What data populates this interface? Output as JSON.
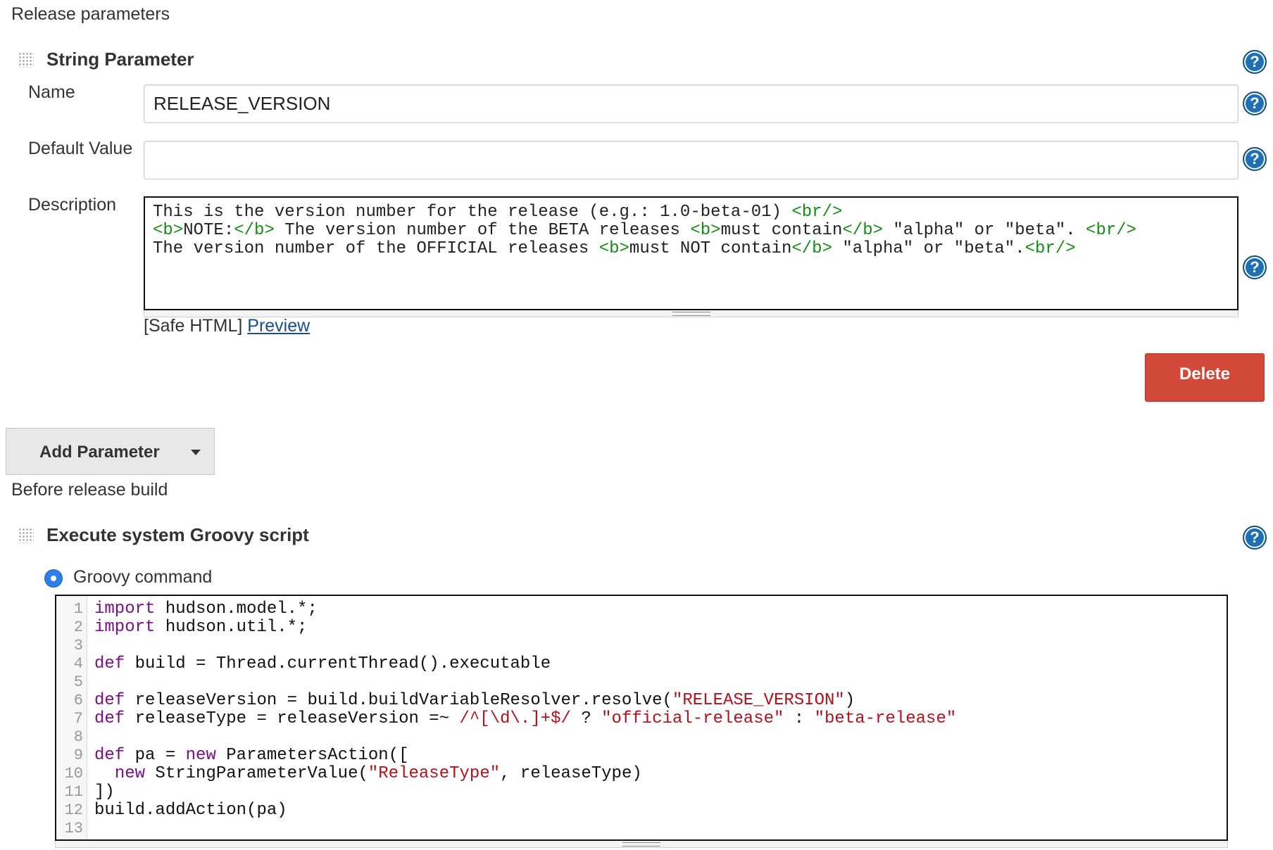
{
  "release_section": {
    "title": "Release parameters",
    "block_title": "String Parameter",
    "name_label": "Name",
    "name_value": "RELEASE_VERSION",
    "default_label": "Default Value",
    "default_value": "",
    "description_label": "Description",
    "description_lines": [
      [
        {
          "t": "This is the version number for the release (e.g.: 1.0-beta-01) ",
          "c": "text"
        },
        {
          "t": "<br/>",
          "c": "tag"
        }
      ],
      [
        {
          "t": "<b>",
          "c": "tag"
        },
        {
          "t": "NOTE:",
          "c": "text"
        },
        {
          "t": "</b>",
          "c": "tag"
        },
        {
          "t": " The version number of the BETA releases ",
          "c": "text"
        },
        {
          "t": "<b>",
          "c": "tag"
        },
        {
          "t": "must contain",
          "c": "text"
        },
        {
          "t": "</b>",
          "c": "tag"
        },
        {
          "t": " \"alpha\" or \"beta\". ",
          "c": "text"
        },
        {
          "t": "<br/>",
          "c": "tag"
        }
      ],
      [
        {
          "t": "The version number of the OFFICIAL releases ",
          "c": "text"
        },
        {
          "t": "<b>",
          "c": "tag"
        },
        {
          "t": "must NOT contain",
          "c": "text"
        },
        {
          "t": "</b>",
          "c": "tag"
        },
        {
          "t": " \"alpha\" or \"beta\".",
          "c": "text"
        },
        {
          "t": "<br/>",
          "c": "tag"
        }
      ]
    ],
    "safe_html_label": "[Safe HTML]",
    "preview_link": "Preview",
    "delete_button": "Delete"
  },
  "add_parameter_button": "Add Parameter",
  "before_build_section": {
    "title": "Before release build",
    "block_title": "Execute system Groovy script",
    "radio_label": "Groovy command",
    "radio_selected": true,
    "code_lines": [
      {
        "n": "1",
        "parts": [
          {
            "t": "import",
            "c": "kw"
          },
          {
            "t": " hudson.model.*;",
            "c": "text"
          }
        ]
      },
      {
        "n": "2",
        "parts": [
          {
            "t": "import",
            "c": "kw"
          },
          {
            "t": " hudson.util.*;",
            "c": "text"
          }
        ]
      },
      {
        "n": "3",
        "parts": []
      },
      {
        "n": "4",
        "parts": [
          {
            "t": "def",
            "c": "kw"
          },
          {
            "t": " build = Thread.currentThread().executable",
            "c": "text"
          }
        ]
      },
      {
        "n": "5",
        "parts": []
      },
      {
        "n": "6",
        "parts": [
          {
            "t": "def",
            "c": "kw"
          },
          {
            "t": " releaseVersion = build.buildVariableResolver.resolve(",
            "c": "text"
          },
          {
            "t": "\"RELEASE_VERSION\"",
            "c": "str"
          },
          {
            "t": ")",
            "c": "text"
          }
        ]
      },
      {
        "n": "7",
        "parts": [
          {
            "t": "def",
            "c": "kw"
          },
          {
            "t": " releaseType = releaseVersion =~ ",
            "c": "text"
          },
          {
            "t": "/^[\\d\\.]+$/",
            "c": "str"
          },
          {
            "t": " ? ",
            "c": "text"
          },
          {
            "t": "\"official-release\"",
            "c": "str"
          },
          {
            "t": " : ",
            "c": "text"
          },
          {
            "t": "\"beta-release\"",
            "c": "str"
          }
        ]
      },
      {
        "n": "8",
        "parts": []
      },
      {
        "n": "9",
        "parts": [
          {
            "t": "def",
            "c": "kw"
          },
          {
            "t": " pa = ",
            "c": "text"
          },
          {
            "t": "new",
            "c": "kw"
          },
          {
            "t": " ParametersAction([",
            "c": "text"
          }
        ]
      },
      {
        "n": "10",
        "parts": [
          {
            "t": "  ",
            "c": "text"
          },
          {
            "t": "new",
            "c": "kw"
          },
          {
            "t": " StringParameterValue(",
            "c": "text"
          },
          {
            "t": "\"ReleaseType\"",
            "c": "str"
          },
          {
            "t": ", releaseType)",
            "c": "text"
          }
        ]
      },
      {
        "n": "11",
        "parts": [
          {
            "t": "])",
            "c": "text"
          }
        ]
      },
      {
        "n": "12",
        "parts": [
          {
            "t": "build.addAction(pa)",
            "c": "text"
          }
        ]
      },
      {
        "n": "13",
        "parts": []
      }
    ]
  },
  "colors": {
    "help_icon": "#1e6fb8",
    "delete_button": "#d24939",
    "tag_green": "#148c14",
    "keyword_purple": "#7a0e88",
    "string_red": "#b0121b"
  }
}
